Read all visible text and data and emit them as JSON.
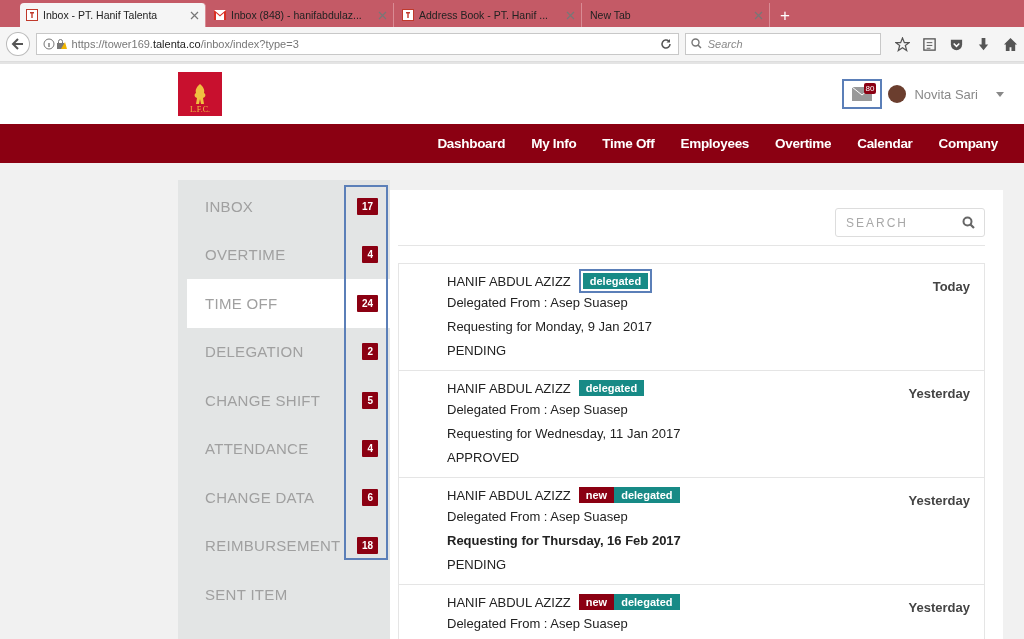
{
  "browser": {
    "tabs": [
      {
        "title": "Inbox - PT. Hanif Talenta",
        "selected": true
      },
      {
        "title": "Inbox (848) - hanifabdulaz...",
        "selected": false
      },
      {
        "title": "Address Book - PT. Hanif ...",
        "selected": false
      },
      {
        "title": "New Tab",
        "selected": false
      }
    ],
    "new_tab": "+",
    "url_prefix": "https://tower169.",
    "url_domain": "talenta.co",
    "url_path": "/inbox/index?type=3",
    "search_placeholder": "Search"
  },
  "header": {
    "logo_text": "L.F.C.",
    "mail_count": "80",
    "mail_highlighted": true,
    "user_name": "Novita Sari"
  },
  "nav": [
    "Dashboard",
    "My Info",
    "Time Off",
    "Employees",
    "Overtime",
    "Calendar",
    "Company"
  ],
  "sidebar": {
    "counts_highlighted": true,
    "items": [
      {
        "label": "INBOX",
        "count": "17",
        "selected": false
      },
      {
        "label": "OVERTIME",
        "count": "4",
        "selected": false
      },
      {
        "label": "TIME OFF",
        "count": "24",
        "selected": true
      },
      {
        "label": "DELEGATION",
        "count": "2",
        "selected": false
      },
      {
        "label": "CHANGE SHIFT",
        "count": "5",
        "selected": false
      },
      {
        "label": "ATTENDANCE",
        "count": "4",
        "selected": false
      },
      {
        "label": "CHANGE DATA",
        "count": "6",
        "selected": false
      },
      {
        "label": "REIMBURSEMENT",
        "count": "18",
        "selected": false
      },
      {
        "label": "SENT ITEM",
        "selected": false
      }
    ]
  },
  "search": {
    "placeholder": "SEARCH"
  },
  "messages": [
    {
      "name": "HANIF ABDUL AZIZZ",
      "tags": [
        {
          "kind": "delegated",
          "text": "delegated",
          "highlighted": true
        }
      ],
      "from": "Delegated From : Asep Suasep",
      "request": "Requesting for Monday, 9 Jan 2017",
      "unread": false,
      "status": "PENDING",
      "date": "Today"
    },
    {
      "name": "HANIF ABDUL AZIZZ",
      "tags": [
        {
          "kind": "delegated",
          "text": "delegated",
          "highlighted": false
        }
      ],
      "from": "Delegated From : Asep Suasep",
      "request": "Requesting for Wednesday, 11 Jan 2017",
      "unread": false,
      "status": "APPROVED",
      "date": "Yesterday"
    },
    {
      "name": "HANIF ABDUL AZIZZ",
      "tags": [
        {
          "kind": "new",
          "text": "new",
          "highlighted": false
        },
        {
          "kind": "delegated",
          "text": "delegated",
          "highlighted": false
        }
      ],
      "from": "Delegated From : Asep Suasep",
      "request": "Requesting for Thursday, 16 Feb 2017",
      "unread": true,
      "status": "PENDING",
      "date": "Yesterday"
    },
    {
      "name": "HANIF ABDUL AZIZZ",
      "tags": [
        {
          "kind": "new",
          "text": "new",
          "highlighted": false
        },
        {
          "kind": "delegated",
          "text": "delegated",
          "highlighted": false
        }
      ],
      "from": "Delegated From : Asep Suasep",
      "date": "Yesterday"
    }
  ]
}
